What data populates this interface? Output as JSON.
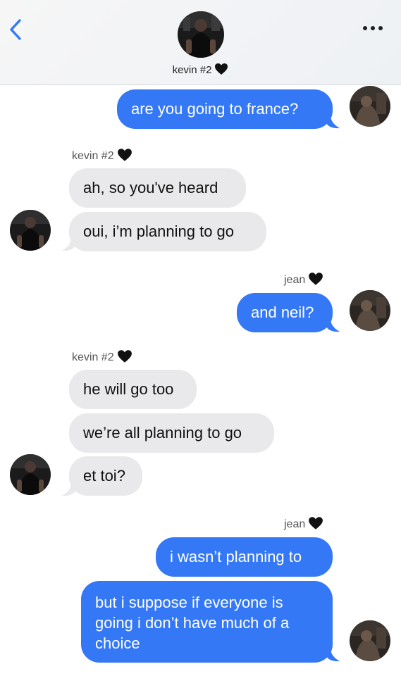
{
  "header": {
    "contact_name": "kevin #2"
  },
  "messages": [
    {
      "text": "are you going to france?"
    },
    {
      "sender": "kevin #2"
    },
    {
      "text": "ah, so you've heard"
    },
    {
      "text": "oui, i’m planning to go"
    },
    {
      "sender": "jean"
    },
    {
      "text": "and neil?"
    },
    {
      "sender": "kevin #2"
    },
    {
      "text": "he will go too"
    },
    {
      "text": "we’re all planning to go"
    },
    {
      "text": "et toi?"
    },
    {
      "sender": "jean"
    },
    {
      "text": "i wasn’t planning to"
    },
    {
      "text": "but i suppose if everyone is going i don’t have much of a choice"
    }
  ],
  "colors": {
    "outgoing_bubble": "#3478f6",
    "incoming_bubble": "#e9e9eb",
    "accent": "#3478f6"
  },
  "icons": {
    "back": "chevron-left-icon",
    "more": "ellipsis-icon",
    "heart": "black-heart-icon"
  }
}
